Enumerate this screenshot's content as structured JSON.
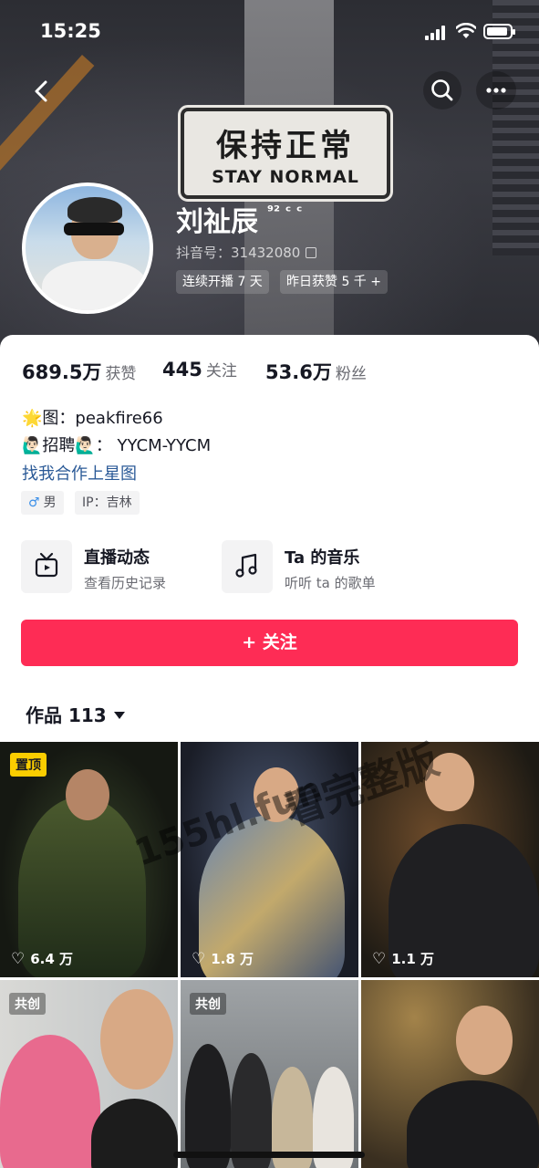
{
  "status_bar": {
    "time": "15:25"
  },
  "banner": {
    "sign_cn": "保持正常",
    "sign_en": "STAY NORMAL"
  },
  "profile": {
    "nickname": "刘祉辰",
    "nickname_suffix": "⁹² ᶜ ᶜ",
    "douyin_id": "抖音号：31432080",
    "tags": [
      "连续开播 7 天",
      "昨日获赞 5 千 +"
    ]
  },
  "stats": [
    {
      "value": "689.5万",
      "label": "获赞"
    },
    {
      "value": "445",
      "label": "关注"
    },
    {
      "value": "53.6万",
      "label": "粉丝"
    }
  ],
  "bio": {
    "line1": "🌟图：peakfire66",
    "line2": "🙋🏻‍♂️招聘🙋🏻‍♂️：  YYCM-YYCM",
    "link": "找我合作上星图"
  },
  "chips": {
    "gender_icon": "♂",
    "gender": "男",
    "ip": "IP：吉林"
  },
  "entries": [
    {
      "title": "直播动态",
      "subtitle": "查看历史记录",
      "icon": "tv-icon"
    },
    {
      "title": "Ta 的音乐",
      "subtitle": "听听 ta 的歌单",
      "icon": "music-icon"
    }
  ],
  "follow_button": "+ 关注",
  "works_tab": "作品 113",
  "watermark": {
    "text1": "155hl.fun",
    "text2": "看完整版"
  },
  "videos": [
    {
      "badge": "置顶",
      "likes": "6.4 万"
    },
    {
      "badge": "",
      "likes": "1.8 万"
    },
    {
      "badge": "",
      "likes": "1.1 万"
    },
    {
      "badge": "共创",
      "likes": ""
    },
    {
      "badge": "共创",
      "likes": ""
    },
    {
      "badge": "",
      "likes": ""
    }
  ],
  "colors": {
    "accent": "#fe2c55",
    "link": "#2b5a97",
    "pin_badge": "#facd00"
  }
}
